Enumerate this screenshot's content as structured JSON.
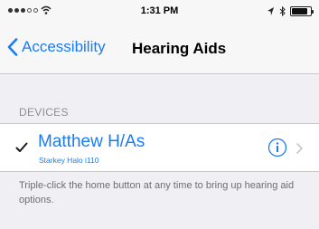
{
  "status_bar": {
    "time": "1:31 PM",
    "battery_level": 0.85
  },
  "nav": {
    "back_label": "Accessibility",
    "title": "Hearing Aids"
  },
  "devices_section": {
    "header": "DEVICES",
    "items": [
      {
        "name": "Matthew H/As",
        "subtitle": "Starkey Halo i110",
        "selected": true
      }
    ]
  },
  "footer": {
    "text": "Triple-click the home button at any time to bring up hearing aid options."
  },
  "colors": {
    "accent": "#1a7cf5",
    "background": "#efeff4"
  },
  "icons": [
    "cellular-signal-icon",
    "wifi-icon",
    "location-arrow-icon",
    "bluetooth-icon",
    "battery-icon",
    "back-chevron-icon",
    "checkmark-icon",
    "info-icon",
    "chevron-right-icon"
  ]
}
